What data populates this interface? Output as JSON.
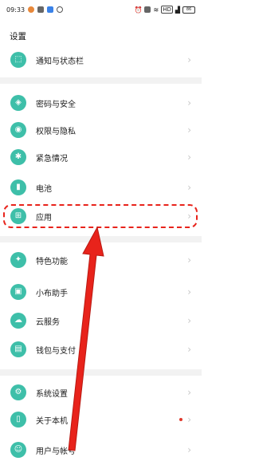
{
  "status_bar": {
    "time": "09:33",
    "left_icons": [
      "notification-app-icon",
      "notification-app-icon",
      "notification-app-icon",
      "notification-app-icon"
    ],
    "right_icons": [
      "alarm-icon",
      "nfc-icon",
      "wifi-icon",
      "signal-icon",
      "battery-icon"
    ],
    "hd_label": "HD",
    "battery_level": "86"
  },
  "page": {
    "title": "设置"
  },
  "settings": [
    {
      "label": "通知与状态栏",
      "icon": "notification-icon",
      "glyph": "⬚"
    },
    {
      "label": "密码与安全",
      "icon": "shield-icon",
      "glyph": "◈"
    },
    {
      "label": "权限与隐私",
      "icon": "privacy-eye-icon",
      "glyph": "◉"
    },
    {
      "label": "紧急情况",
      "icon": "emergency-icon",
      "glyph": "✱"
    },
    {
      "label": "电池",
      "icon": "battery-icon",
      "glyph": "▮"
    },
    {
      "label": "应用",
      "icon": "apps-grid-icon",
      "glyph": "⊞"
    },
    {
      "label": "特色功能",
      "icon": "feature-icon",
      "glyph": "✦"
    },
    {
      "label": "小布助手",
      "icon": "assistant-icon",
      "glyph": "▣"
    },
    {
      "label": "云服务",
      "icon": "cloud-icon",
      "glyph": "☁"
    },
    {
      "label": "钱包与支付",
      "icon": "wallet-icon",
      "glyph": "▤"
    },
    {
      "label": "系统设置",
      "icon": "system-gear-icon",
      "glyph": "⚙"
    },
    {
      "label": "关于本机",
      "icon": "phone-icon",
      "glyph": "▯"
    },
    {
      "label": "用户与帐号",
      "icon": "user-icon",
      "glyph": "☺"
    }
  ],
  "colors": {
    "icon_bg": "#3ebfa9",
    "highlight": "#e8231b",
    "badge": "#e0382b"
  },
  "annotation": {
    "target": "应用"
  }
}
